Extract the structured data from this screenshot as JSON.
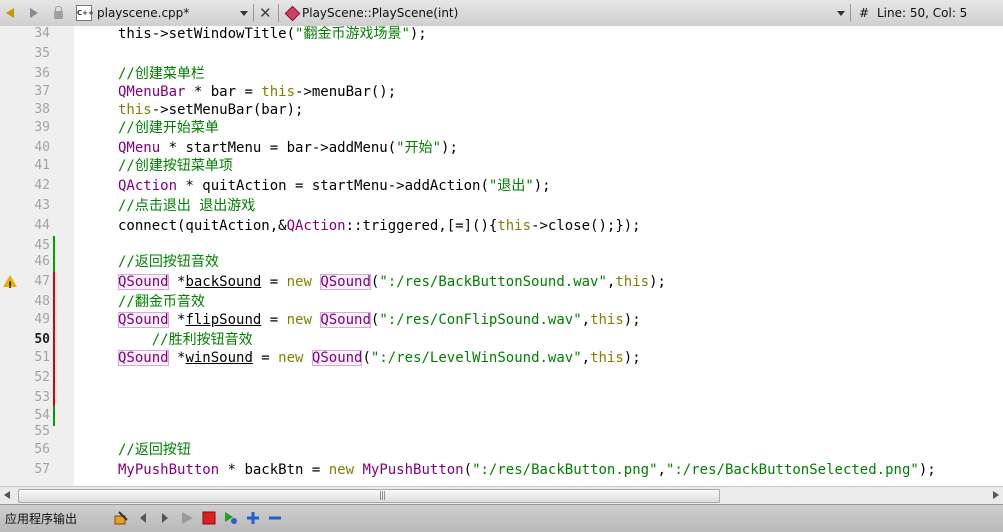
{
  "toolbar": {
    "file_name": "playscene.cpp*",
    "function_name": "PlayScene::PlayScene(int)",
    "hash": "#",
    "position": "Line: 50, Col: 5",
    "cpp_badge": "C++"
  },
  "code": {
    "lines": [
      {
        "n": "34",
        "segs": [
          [
            "p",
            "this"
          ],
          [
            "p",
            "->setWindowTitle("
          ],
          [
            "st",
            "\"翻金币游戏场景\""
          ],
          [
            "p",
            ");"
          ]
        ]
      },
      {
        "n": "35",
        "segs": []
      },
      {
        "n": "36",
        "segs": [
          [
            "cm",
            "//创建菜单栏"
          ]
        ]
      },
      {
        "n": "37",
        "segs": [
          [
            "ty",
            "QMenuBar"
          ],
          [
            "p",
            " * bar = "
          ],
          [
            "kw",
            "this"
          ],
          [
            "p",
            "->menuBar();"
          ]
        ]
      },
      {
        "n": "38",
        "segs": [
          [
            "kw",
            "this"
          ],
          [
            "p",
            "->setMenuBar(bar);"
          ]
        ]
      },
      {
        "n": "39",
        "segs": [
          [
            "cm",
            "//创建开始菜单"
          ]
        ]
      },
      {
        "n": "40",
        "segs": [
          [
            "ty",
            "QMenu"
          ],
          [
            "p",
            " * startMenu = bar->addMenu("
          ],
          [
            "st",
            "\"开始\""
          ],
          [
            "p",
            ");"
          ]
        ]
      },
      {
        "n": "41",
        "segs": [
          [
            "cm",
            "//创建按钮菜单项"
          ]
        ]
      },
      {
        "n": "42",
        "segs": [
          [
            "ty",
            "QAction"
          ],
          [
            "p",
            " * quitAction = startMenu->addAction("
          ],
          [
            "st",
            "\"退出\""
          ],
          [
            "p",
            ");"
          ]
        ]
      },
      {
        "n": "43",
        "segs": [
          [
            "cm",
            "//点击退出 退出游戏"
          ]
        ]
      },
      {
        "n": "44",
        "segs": [
          [
            "p",
            "connect(quitAction,&"
          ],
          [
            "ty",
            "QAction"
          ],
          [
            "p",
            "::triggered,[=](){"
          ],
          [
            "kw",
            "this"
          ],
          [
            "p",
            "->close();});"
          ]
        ]
      },
      {
        "n": "45",
        "segs": []
      },
      {
        "n": "46",
        "segs": [
          [
            "cm",
            "//返回按钮音效"
          ]
        ]
      },
      {
        "n": "47",
        "segs": [
          [
            "tyb",
            "QSound"
          ],
          [
            "p",
            " *"
          ],
          [
            "ul",
            "backSound"
          ],
          [
            "p",
            " = "
          ],
          [
            "kw",
            "new"
          ],
          [
            "p",
            " "
          ],
          [
            "tyb",
            "QSound"
          ],
          [
            "p",
            "("
          ],
          [
            "st",
            "\":/res/BackButtonSound.wav\""
          ],
          [
            "p",
            ","
          ],
          [
            "kw",
            "this"
          ],
          [
            "p",
            ");"
          ]
        ]
      },
      {
        "n": "48",
        "segs": [
          [
            "cm",
            "//翻金币音效"
          ]
        ]
      },
      {
        "n": "49",
        "segs": [
          [
            "tyb",
            "QSound"
          ],
          [
            "p",
            " *"
          ],
          [
            "ul",
            "flipSound"
          ],
          [
            "p",
            " = "
          ],
          [
            "kw",
            "new"
          ],
          [
            "p",
            " "
          ],
          [
            "tyb",
            "QSound"
          ],
          [
            "p",
            "("
          ],
          [
            "st",
            "\":/res/ConFlipSound.wav\""
          ],
          [
            "p",
            ","
          ],
          [
            "kw",
            "this"
          ],
          [
            "p",
            ");"
          ]
        ]
      },
      {
        "n": "50",
        "segs": [
          [
            "p",
            "    "
          ],
          [
            "cm",
            "//胜利按钮音效"
          ]
        ]
      },
      {
        "n": "51",
        "segs": [
          [
            "tyb",
            "QSound"
          ],
          [
            "p",
            " *"
          ],
          [
            "ul",
            "winSound"
          ],
          [
            "p",
            " = "
          ],
          [
            "kw",
            "new"
          ],
          [
            "p",
            " "
          ],
          [
            "tyb",
            "QSound"
          ],
          [
            "p",
            "("
          ],
          [
            "st",
            "\":/res/LevelWinSound.wav\""
          ],
          [
            "p",
            ","
          ],
          [
            "kw",
            "this"
          ],
          [
            "p",
            ");"
          ]
        ]
      },
      {
        "n": "52",
        "segs": []
      },
      {
        "n": "53",
        "segs": []
      },
      {
        "n": "54",
        "segs": []
      },
      {
        "n": "55",
        "segs": []
      },
      {
        "n": "56",
        "segs": [
          [
            "cm",
            "//返回按钮"
          ]
        ]
      },
      {
        "n": "57",
        "segs": [
          [
            "ty",
            "MyPushButton"
          ],
          [
            "p",
            " * backBtn = "
          ],
          [
            "kw",
            "new"
          ],
          [
            "p",
            " "
          ],
          [
            "ty",
            "MyPushButton"
          ],
          [
            "p",
            "("
          ],
          [
            "st",
            "\":/res/BackButton.png\""
          ],
          [
            "p",
            ","
          ],
          [
            "st",
            "\":/res/BackButtonSelected.png\""
          ],
          [
            "p",
            ");"
          ]
        ]
      }
    ]
  },
  "scroll": {
    "grip": "|||"
  },
  "bottom_panel": {
    "label": "应用程序输出"
  },
  "colors": {
    "keyword": "#808000",
    "type": "#800080",
    "comment": "#008000",
    "string": "#008000",
    "modified_marker": "#e00000",
    "saved_marker": "#00a000"
  }
}
